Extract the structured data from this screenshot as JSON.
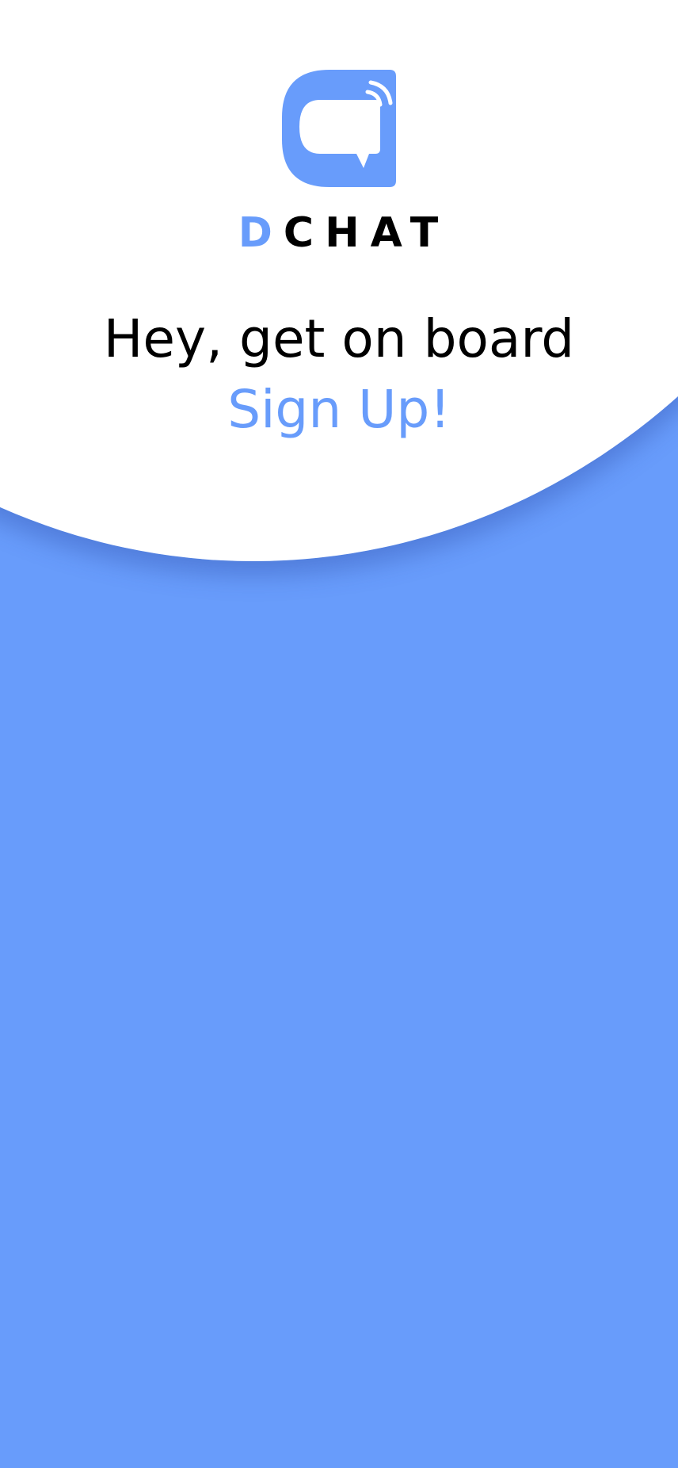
{
  "brand": {
    "first_letter": "D",
    "rest": "CHAT",
    "accent_color": "#689cfb",
    "logo_icon": "chat-bubble-signal-icon"
  },
  "hero": {
    "headline": "Hey, get on board",
    "signup_link": "Sign Up!"
  },
  "colors": {
    "background": "#689cfb",
    "surface": "#ffffff",
    "text": "#000000"
  }
}
